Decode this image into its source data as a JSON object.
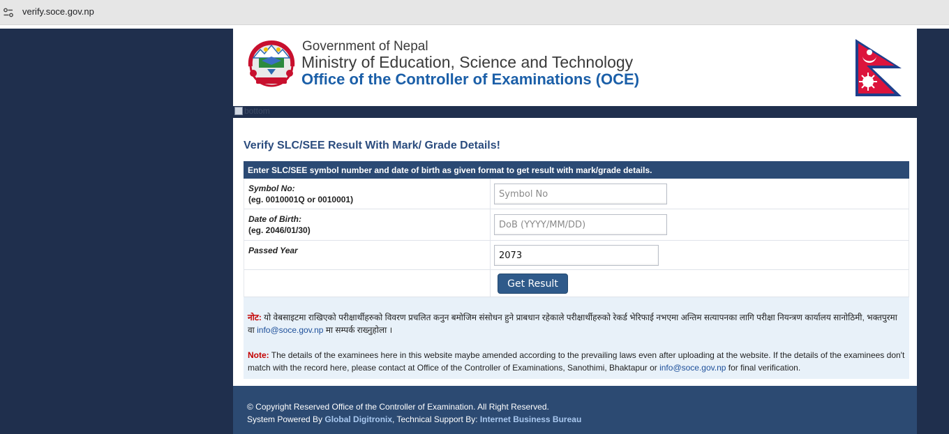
{
  "browser": {
    "url": "verify.soce.gov.np"
  },
  "header": {
    "gov_line": "Government of Nepal",
    "ministry_line": "Ministry of Education, Science and Technology",
    "office_line": "Office of the Controller of Examinations (OCE)"
  },
  "band": {
    "broken_image_alt": "bottom"
  },
  "form": {
    "title": "Verify SLC/SEE Result With Mark/ Grade Details!",
    "instruction": "Enter SLC/SEE symbol number and date of birth as given format to get result with mark/grade details.",
    "symbol_label": "Symbol No:",
    "symbol_example": "(eg. 0010001Q or 0010001)",
    "symbol_placeholder": "Symbol No",
    "dob_label": "Date of Birth:",
    "dob_example": "(eg. 2046/01/30)",
    "dob_placeholder": "DoB (YYYY/MM/DD)",
    "year_label": "Passed Year",
    "year_value": "2073",
    "submit_label": "Get Result"
  },
  "notes": {
    "np_label": "नोट:",
    "np_text": " यो वेबसाइटमा राखिएको परीक्षार्थीहरुको विवरण प्रचलित कनुन बमोजिम संसोधन हुने प्राबधान रहेकाले परीक्षार्थीहरुको रेकर्ड भेरिफाई नभएमा अन्तिम सत्यापनका लागि परीक्षा नियन्त्रण कार्यालय सानोठिमी, भक्तपुरमा वा ",
    "np_email": "info@soce.gov.np",
    "np_text_end": " मा सम्पर्क राख्नुहोला ।",
    "en_label": "Note:",
    "en_text": " The details of the examinees here in this website maybe amended according to the prevailing laws even after uploading at the website. If the details of the examinees don't match with the record here, please contact at Office of the Controller of Examinations, Sanothimi, Bhaktapur or ",
    "en_email": "info@soce.gov.np",
    "en_text_end": " for final verification."
  },
  "footer": {
    "copyright": "© Copyright Reserved Office of the Controller of Examination. All Right Reserved.",
    "powered_prefix": "System Powered By ",
    "powered_by": "Global Digitronix",
    "support_prefix": ", Technical Support By: ",
    "support_by": "Internet Business Bureau"
  },
  "icons": {
    "site_info": "tune-icon",
    "emblem": "nepal-emblem-icon",
    "flag": "nepal-flag-icon",
    "broken_image": "broken-image-icon"
  },
  "colors": {
    "page_bg": "#1f2f4d",
    "accent": "#2b4a74",
    "title_blue": "#1b5fa8",
    "note_red": "#c40000",
    "button": "#2f5a8a"
  }
}
